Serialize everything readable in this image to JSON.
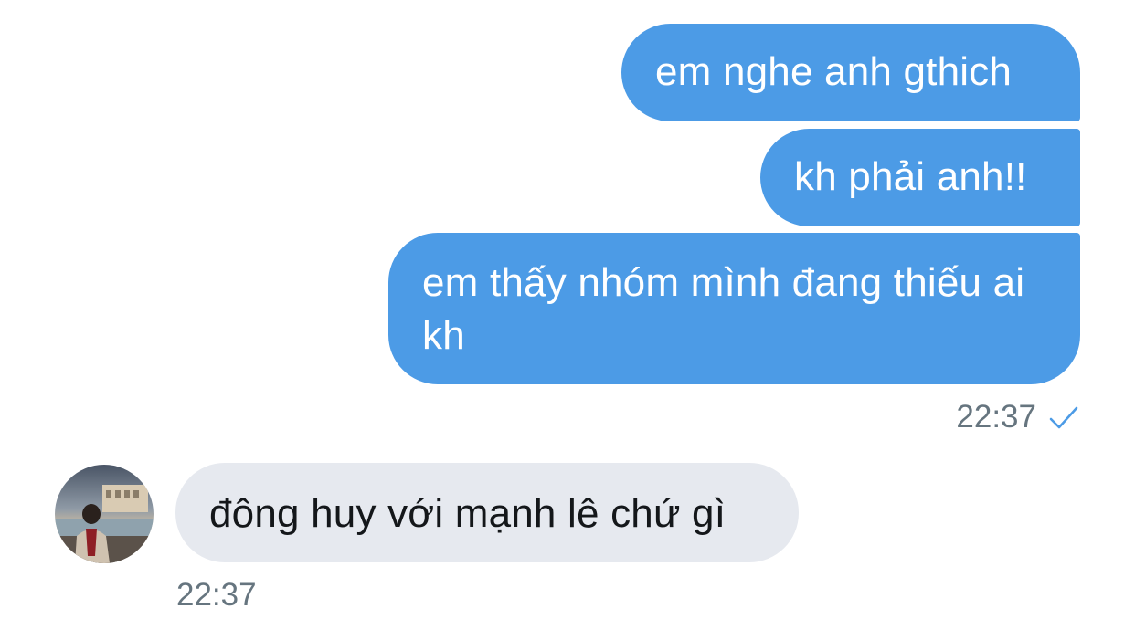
{
  "conversation": {
    "outgoing": [
      {
        "text": "em nghe anh gthich"
      },
      {
        "text": "kh phải anh!!"
      },
      {
        "text": "em thấy nhóm mình đang thiếu ai kh"
      }
    ],
    "outgoing_time": "22:37",
    "outgoing_status_icon": "checkmark-icon",
    "incoming": [
      {
        "text": "đông huy với mạnh lê chứ gì"
      }
    ],
    "incoming_time": "22:37",
    "incoming_avatar": "avatar-photo"
  },
  "colors": {
    "outgoing_bubble": "#4c9be6",
    "incoming_bubble": "#e6e9ef",
    "timestamp": "#66757f",
    "checkmark": "#4c9be6"
  }
}
